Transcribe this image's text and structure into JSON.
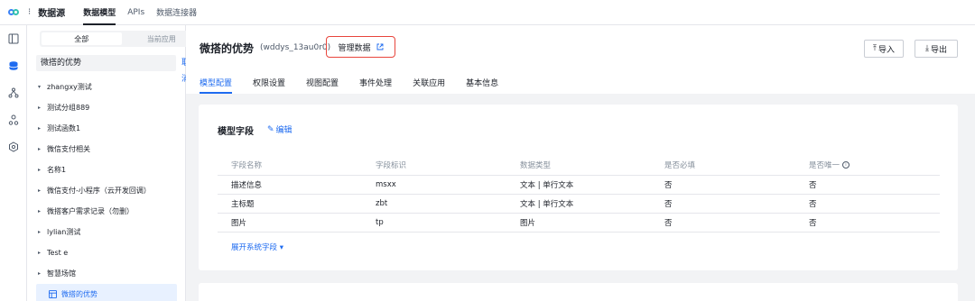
{
  "topbar": {
    "title": "数据源",
    "tabs": [
      {
        "label": "数据模型",
        "active": true
      },
      {
        "label": "APIs",
        "active": false
      },
      {
        "label": "数据连接器",
        "active": false
      }
    ]
  },
  "rail": {
    "icons": [
      "panel-icon",
      "database-icon",
      "flow-icon",
      "org-icon",
      "hexagon-icon"
    ]
  },
  "left": {
    "segments": {
      "all": "全部",
      "current": "当前应用"
    },
    "search_value": "微搭的优势",
    "cancel_label": "取消",
    "items": [
      {
        "label": "zhangxy测试",
        "caret": "▾"
      },
      {
        "label": "测试分组889",
        "caret": "▸"
      },
      {
        "label": "测试函数1",
        "caret": "▸"
      },
      {
        "label": "微信支付相关",
        "caret": "▸"
      },
      {
        "label": "名称1",
        "caret": "▸"
      },
      {
        "label": "微信支付-小程序（云开发回调）",
        "caret": "▸"
      },
      {
        "label": "微搭客户需求记录（勿删）",
        "caret": "▸"
      },
      {
        "label": "lylian测试",
        "caret": "▸"
      },
      {
        "label": "Test e",
        "caret": "▸"
      },
      {
        "label": "智慧场馆",
        "caret": "▸"
      }
    ],
    "selected": "微搭的优势"
  },
  "main": {
    "title": "微搭的优势",
    "subtitle": "(wddys_13au0r0)",
    "manage_label": "管理数据",
    "import_label": "导入",
    "export_label": "导出",
    "tabs": [
      {
        "label": "模型配置",
        "active": true
      },
      {
        "label": "权限设置",
        "active": false
      },
      {
        "label": "视图配置",
        "active": false
      },
      {
        "label": "事件处理",
        "active": false
      },
      {
        "label": "关联应用",
        "active": false
      },
      {
        "label": "基本信息",
        "active": false
      }
    ],
    "card": {
      "title": "模型字段",
      "edit_label": "编辑",
      "columns": [
        "字段名称",
        "字段标识",
        "数据类型",
        "是否必填",
        "是否唯一"
      ],
      "rows": [
        [
          "描述信息",
          "msxx",
          "文本 | 单行文本",
          "否",
          "否"
        ],
        [
          "主标题",
          "zbt",
          "文本 | 单行文本",
          "否",
          "否"
        ],
        [
          "图片",
          "tp",
          "图片",
          "否",
          "否"
        ]
      ],
      "expand_label": "展开系统字段 ▾"
    }
  },
  "colors": {
    "accent": "#1e6bf0",
    "highlight": "#e8453c"
  }
}
